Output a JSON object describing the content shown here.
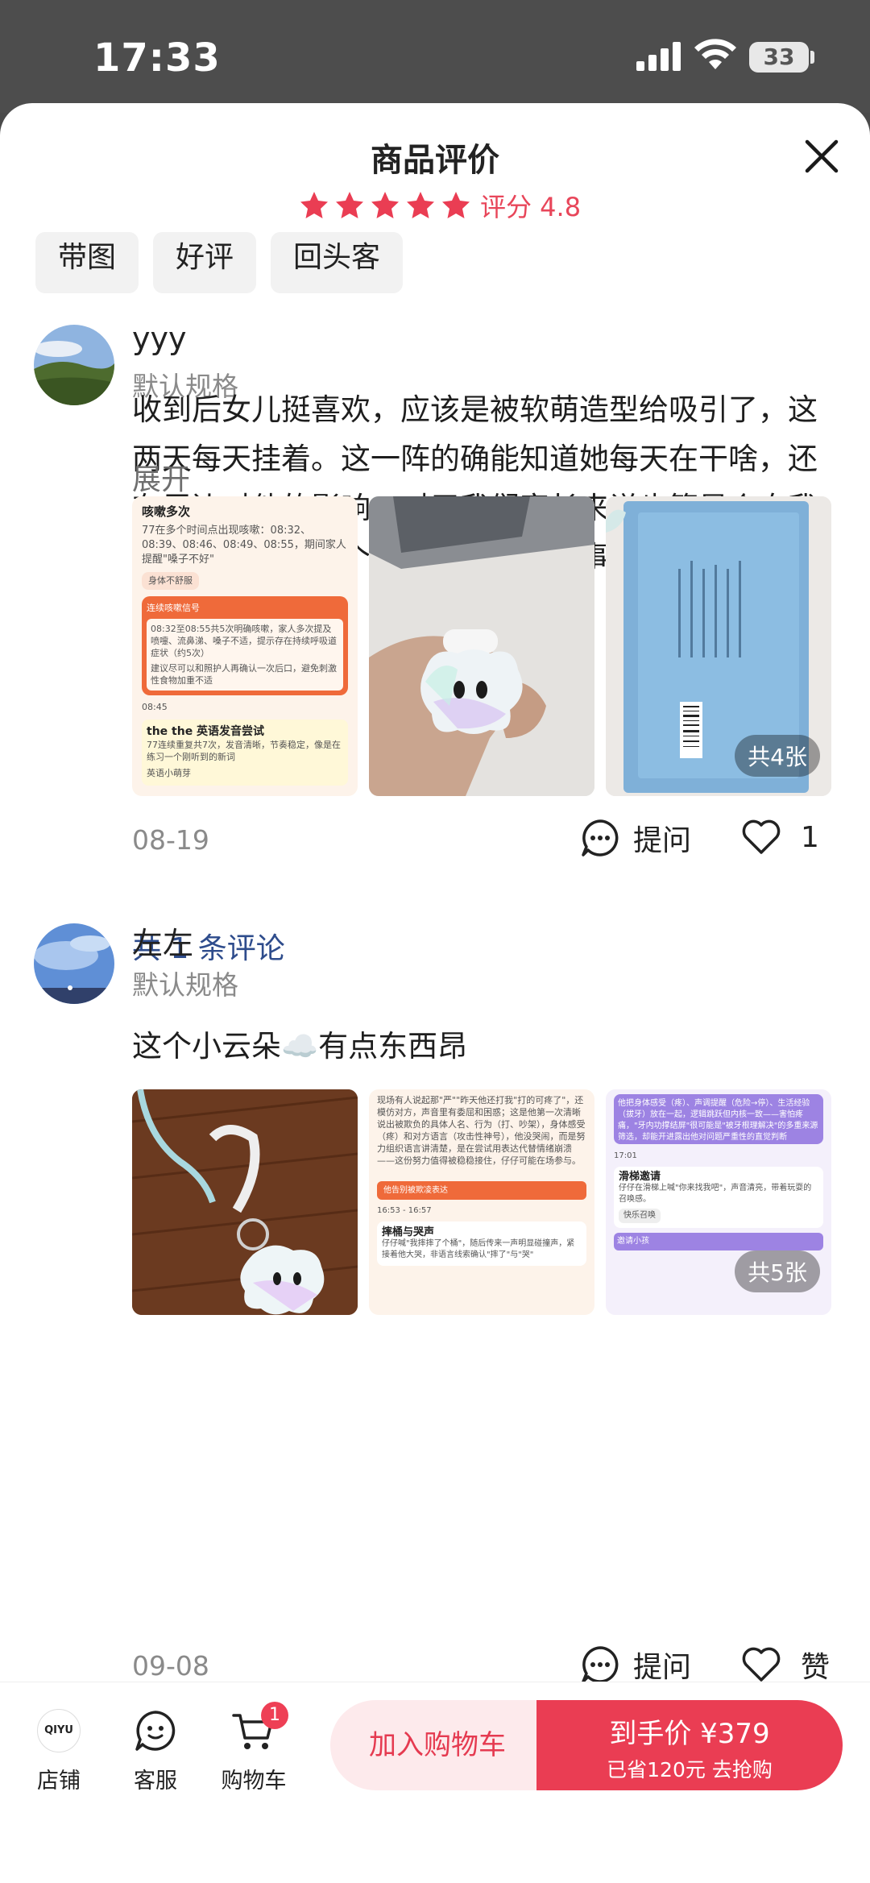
{
  "status_bar": {
    "time": "17:33",
    "battery": "33"
  },
  "header": {
    "title": "商品评价",
    "rating_text": "评分 4.8",
    "stars": 5
  },
  "filters": [
    "带图",
    "好评",
    "回头客"
  ],
  "reviews": [
    {
      "user": "yyy",
      "spec": "默认规格",
      "text": "收到后女儿挺喜欢，应该是被软萌造型给吸引了，这两天每天挂着。这一阵的确能知道她每天在干啥，还有周边对他的影响，对于我们家长来说也算是个自我提醒，这两天有个非常让人惊喜的事情，这个东西竟然识别出我女儿咳嗽，我开始",
      "expand": "展开",
      "photo_count": "共4张",
      "date": "08-19",
      "ask_label": "提问",
      "like_count": "1",
      "comments_link": "共 1 条评论",
      "photo1": {
        "heading": "咳嗽多次",
        "detail": "77在多个时间点出现咳嗽：08:32、08:39、08:46、08:49、08:55，期间家人提醒\"嗓子不好\"",
        "tag": "身体不舒服",
        "alert_title": "连续咳嗽信号",
        "alert_text": "08:32至08:55共5次明确咳嗽，家人多次提及喷嚏、流鼻涕、嗓子不适，提示存在持续呼吸道症状（约5次）",
        "alert_tip": "建议尽可以和照护人再确认一次后口，避免刺激性食物加重不适",
        "time2": "08:45",
        "heading2": "the the 英语发音尝试",
        "detail2": "77连续重复共7次，发音清晰，节奏稳定，像是在练习一个刚听到的新词",
        "tag2": "英语小萌芽"
      }
    },
    {
      "user": "左左",
      "spec": "默认规格",
      "text": "这个小云朵☁️有点东西昂",
      "photo_count": "共5张",
      "date": "09-08",
      "ask_label": "提问",
      "like_label": "赞",
      "photo2": {
        "text": "现场有人说起那\"严\"\"昨天他还打我\"打的可疼了\"，还模仿对方，声音里有委屈和困惑；这是他第一次清晰说出被欺负的具体人名、行为（打、吵架），身体感受（疼）和对方语言（攻击性神号），他没哭闹，而是努力组织语言讲清楚，是在尝试用表达代替情绪崩溃——这份努力值得被稳稳接住，仔仔可能在场参与。",
        "button": "他告别被欺凌表达",
        "time": "16:53 - 16:57",
        "heading": "摔桶与哭声",
        "detail": "仔仔喊\"我摔摔了个桶\"，随后传来一声明显碰撞声，紧接着他大哭，非语言线索确认\"摔了\"与\"哭\""
      },
      "photo3": {
        "text": "他把身体感受（疼）、声调提醒（危险→停）、生活经验（拔牙）放在一起，逻辑跳跃但内核一致——害怕疼痛，\"牙内功撑结屏\"很可能是\"被牙根理解决\"的多重来源筛选，却能开进露出他对问题严重性的直觉判断",
        "time": "17:01",
        "heading": "滑梯邀请",
        "detail": "仔仔在滑梯上喊\"你来找我吧\"，声音清亮，带着玩耍的召唤感。",
        "tag": "快乐召唤",
        "footer": "邀请小孩"
      }
    }
  ],
  "bottom_bar": {
    "store": "店铺",
    "store_logo": "QIYU",
    "service": "客服",
    "cart": "购物车",
    "cart_badge": "1",
    "add_cart": "加入购物车",
    "price": "到手价 ¥379",
    "save": "已省120元 去抢购"
  },
  "colors": {
    "accent": "#ea3d53",
    "link": "#2e4c8c"
  }
}
